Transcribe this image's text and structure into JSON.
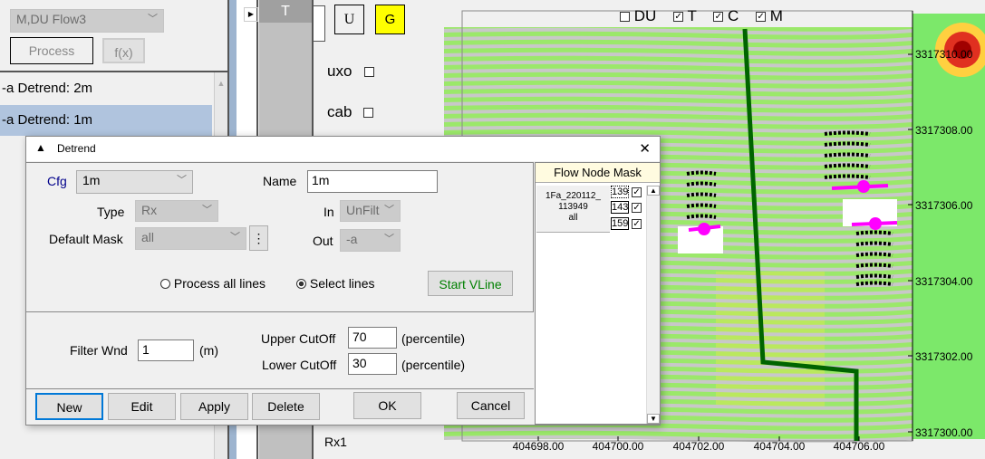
{
  "left_panel": {
    "flow_select": "M,DU Flow3",
    "process_label": "Process",
    "fx_label": "f(x)",
    "list_items": [
      "-a Detrend: 2m",
      "-a Detrend: 1m"
    ],
    "selected_index": 1
  },
  "middle": {
    "column_header": "T",
    "u_label": "U",
    "g_label": "G",
    "uxo_label": "uxo",
    "cab_label": "cab",
    "rx_label": "Rx1",
    "uxo_checked": false,
    "cab_checked": false
  },
  "map": {
    "layers": [
      {
        "label": "DU",
        "checked": false
      },
      {
        "label": "T",
        "checked": true
      },
      {
        "label": "C",
        "checked": true
      },
      {
        "label": "M",
        "checked": true
      }
    ],
    "y_ticks": [
      "3317310.00",
      "3317308.00",
      "3317306.00",
      "3317304.00",
      "3317302.00",
      "3317300.00"
    ],
    "x_ticks": [
      "404698.00",
      "404700.00",
      "404702.00",
      "404704.00",
      "404706.00"
    ]
  },
  "dialog": {
    "title": "Detrend",
    "close": "✕",
    "cfg_label": "Cfg",
    "cfg_value": "1m",
    "name_label": "Name",
    "name_value": "1m",
    "type_label": "Type",
    "type_value": "Rx",
    "in_label": "In",
    "in_value": "UnFilt",
    "mask_label": "Default Mask",
    "mask_value": "all",
    "mask_more": "⋮",
    "out_label": "Out",
    "out_value": "-a",
    "radio_all": "Process all lines",
    "radio_select": "Select lines",
    "selected_radio": "select",
    "start_vline": "Start VLine",
    "filter_label": "Filter Wnd",
    "filter_value": "1",
    "filter_unit": "(m)",
    "upper_label": "Upper CutOff",
    "upper_value": "70",
    "lower_label": "Lower CutOff",
    "lower_value": "30",
    "percentile": "(percentile)",
    "buttons": {
      "new": "New",
      "edit": "Edit",
      "apply": "Apply",
      "delete": "Delete",
      "ok": "OK",
      "cancel": "Cancel"
    },
    "mask_panel": {
      "header": "Flow Node Mask",
      "file_line1": "1Fa_220112_",
      "file_line2": "113949",
      "file_line3": "all",
      "nodes": [
        {
          "id": "139",
          "checked": true
        },
        {
          "id": "143",
          "checked": true
        },
        {
          "id": "159",
          "checked": true
        }
      ]
    },
    "accent": "#0078d7",
    "start_vline_color": "#008000"
  }
}
